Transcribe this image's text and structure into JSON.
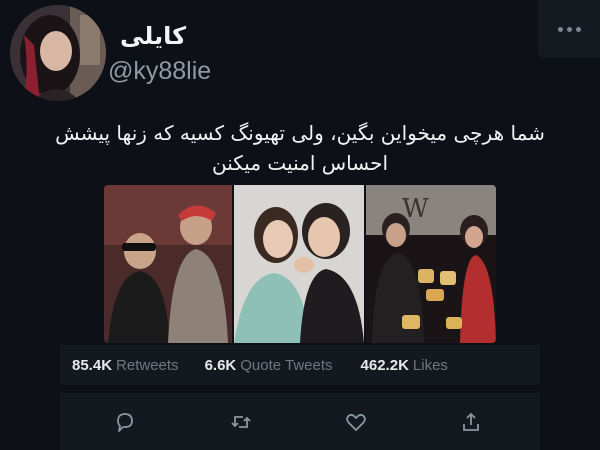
{
  "author": {
    "display_name": "کایلی",
    "handle": "@ky88lie",
    "avatar_icon": "profile-photo"
  },
  "tweet": {
    "text_line1": "شما هرچی میخواین بگین، ولی تهیونگ کسیه که زنها پیشش",
    "text_line2": "احساس امنیت میکنن"
  },
  "media": {
    "count": 3,
    "photos": [
      "photo-1",
      "photo-2",
      "photo-3"
    ],
    "photo3_sign": "W"
  },
  "stats": {
    "retweets_count": "85.4K",
    "retweets_label": "Retweets",
    "quotes_count": "6.6K",
    "quotes_label": "Quote Tweets",
    "likes_count": "462.2K",
    "likes_label": "Likes"
  },
  "actions": [
    "reply-icon",
    "retweet-icon",
    "like-icon",
    "share-icon"
  ],
  "colors": {
    "background": "#0d1117",
    "panel": "#141920",
    "text": "#e7e9ea",
    "muted": "#6e7781"
  }
}
